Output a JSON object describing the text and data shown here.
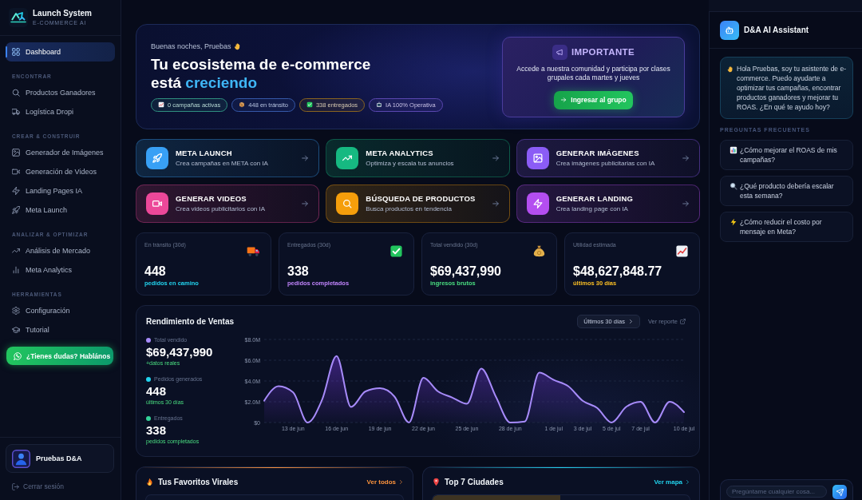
{
  "sidebar": {
    "brand": {
      "name": "Launch System",
      "tagline": "E-COMMERCE AI"
    },
    "nav": [
      {
        "label": "Dashboard",
        "selected": true
      }
    ],
    "sections": [
      {
        "heading": "ENCONTRAR",
        "items": [
          {
            "label": "Productos Ganadores",
            "selected": false
          },
          {
            "label": "Logística Dropi",
            "selected": false
          }
        ]
      },
      {
        "heading": "CREAR & CONSTRUIR",
        "items": [
          {
            "label": "Generador de Imágenes",
            "selected": false
          },
          {
            "label": "Generación de Videos",
            "selected": false
          },
          {
            "label": "Landing Pages IA",
            "selected": false
          },
          {
            "label": "Meta Launch",
            "selected": false
          }
        ]
      },
      {
        "heading": "ANALIZAR & OPTIMIZAR",
        "items": [
          {
            "label": "Análisis de Mercado",
            "selected": false
          },
          {
            "label": "Meta Analytics",
            "selected": false
          }
        ]
      },
      {
        "heading": "HERRAMIENTAS",
        "items": [
          {
            "label": "Configuración",
            "selected": false
          },
          {
            "label": "Tutorial",
            "selected": false
          }
        ]
      }
    ],
    "help_button": "¿Tienes dudas? Hablános",
    "user": {
      "name": "Pruebas D&A"
    },
    "logout": "Cerrar sesión"
  },
  "hero": {
    "greeting": "Buenas noches, Pruebas",
    "title": "Tu ecosistema de e-commerce está",
    "title_highlight": "creciendo",
    "pills": [
      {
        "label": "0 campañas activas",
        "color": "#2f8f80"
      },
      {
        "label": "448 en tránsito",
        "color": "#3558a8"
      },
      {
        "label": "338 entregados",
        "color": "#8a6420"
      },
      {
        "label": "IA 100% Operativa",
        "color": "#5a47b0"
      }
    ],
    "notice": {
      "heading": "IMPORTANTE",
      "text": "Accede a nuestra comunidad y participa por clases grupales cada martes y jueves",
      "button": "Ingresar al grupo"
    }
  },
  "actions": [
    {
      "title": "META LAUNCH",
      "subtitle": "Crea campañas en META con IA",
      "color": "#38a0f5"
    },
    {
      "title": "META ANALYTICS",
      "subtitle": "Optimiza y escala tus anuncios",
      "color": "#16b981"
    },
    {
      "title": "GENERAR IMÁGENES",
      "subtitle": "Crea imágenes publicitarias con IA",
      "color": "#8b5cf6"
    },
    {
      "title": "GENERAR VIDEOS",
      "subtitle": "Crea videos publicitarios con IA",
      "color": "#ec4899"
    },
    {
      "title": "BÚSQUEDA DE PRODUCTOS",
      "subtitle": "Busca productos en tendencia",
      "color": "#f59e0b"
    },
    {
      "title": "GENERAR LANDING",
      "subtitle": "Crea landing page con IA",
      "color": "#b44ef0"
    }
  ],
  "stats": [
    {
      "label": "En tránsito (30d)",
      "value": "448",
      "note": "pedidos en camino",
      "color": "#22d3ee"
    },
    {
      "label": "Entregados (30d)",
      "value": "338",
      "note": "pedidos completados",
      "color": "#c084fc"
    },
    {
      "label": "Total vendido (30d)",
      "value": "$69,437,990",
      "note": "ingresos brutos",
      "color": "#4ade80"
    },
    {
      "label": "Utilidad estimada",
      "value": "$48,627,848.77",
      "note": "últimos 30 días",
      "color": "#fbbf24"
    }
  ],
  "sales": {
    "title": "Rendimiento de Ventas",
    "range_button": "Últimos 30 días",
    "report_link": "Ver reporte",
    "legend": [
      {
        "label": "Total vendido",
        "value": "$69,437,990",
        "note": "+datos reales",
        "color": "#a78bfa"
      },
      {
        "label": "Pedidos generados",
        "value": "448",
        "note": "últimos 30 días",
        "color": "#22d3ee"
      },
      {
        "label": "Entregados",
        "value": "338",
        "note": "pedidos completados",
        "color": "#34d399"
      }
    ],
    "chart_data": {
      "type": "area",
      "categories": [
        null,
        null,
        "13 de jun",
        null,
        null,
        "16 de jun",
        null,
        null,
        "19 de jun",
        null,
        null,
        "22 de jun",
        null,
        null,
        "25 de jun",
        null,
        null,
        "28 de jun",
        null,
        null,
        "1 de jul",
        null,
        "3 de jul",
        null,
        "5 de jul",
        null,
        "7 de jul",
        null,
        null,
        "10 de jul"
      ],
      "values": [
        2.1,
        3.5,
        2.9,
        0,
        2.2,
        6.4,
        1.5,
        3.0,
        3.3,
        2.5,
        0,
        4.3,
        3.0,
        2.4,
        1.8,
        5.2,
        2.5,
        0,
        0.1,
        4.8,
        4.1,
        3.5,
        2.1,
        1.4,
        0,
        1.5,
        2.0,
        0,
        2.0,
        1.0
      ],
      "ylim": [
        0,
        8
      ],
      "yticks": [
        {
          "value": 0,
          "label": "$0"
        },
        {
          "value": 2,
          "label": "$2.0M"
        },
        {
          "value": 4,
          "label": "$4.0M"
        },
        {
          "value": 6,
          "label": "$6.0M"
        },
        {
          "value": 8,
          "label": "$8.0M"
        }
      ],
      "grid": true
    }
  },
  "panels": [
    {
      "title": "Tus Favoritos Virales",
      "link": "Ver todos",
      "color": "#fb923c"
    },
    {
      "title": "Top 7 Ciudades",
      "link": "Ver mapa",
      "color": "#22d3ee"
    }
  ],
  "assistant": {
    "title": "D&A AI Assistant",
    "message": "Hola Pruebas, soy tu asistente de e-commerce. Puedo ayudarte a optimizar tus campañas, encontrar productos ganadores y mejorar tu ROAS. ¿En qué te ayudo hoy?",
    "faq_heading": "PREGUNTAS FRECUENTES",
    "faq": [
      "¿Cómo mejorar el ROAS de mis campañas?",
      "¿Qué producto debería escalar esta semana?",
      "¿Cómo reducir el costo por mensaje en Meta?"
    ],
    "input": {
      "placeholder": "Pregúntame cualquier cosa..."
    }
  }
}
